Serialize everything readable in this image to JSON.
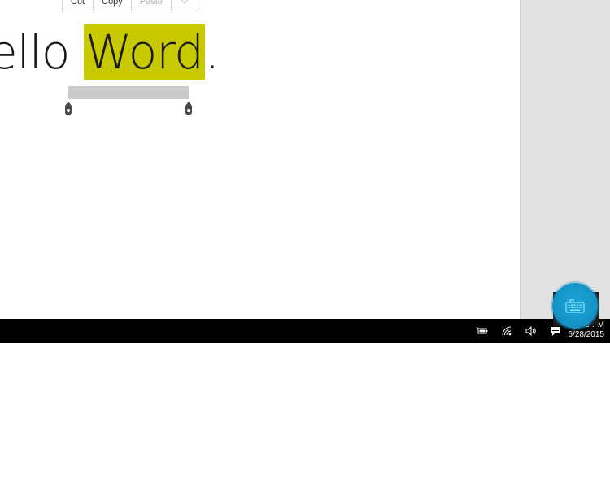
{
  "context_menu": {
    "cut_label": "Cut",
    "copy_label": "Copy",
    "paste_label": "Paste",
    "more_icon": "chevron-down-icon"
  },
  "document": {
    "text_before": "ello ",
    "selected_text": "Word",
    "text_after": ".",
    "selection_color": "#c9c900"
  },
  "taskbar": {
    "time": "2:35 PM",
    "date": "6/28/2015",
    "icons": [
      "battery-icon",
      "wifi-icon",
      "volume-icon",
      "action-center-icon"
    ]
  },
  "floating_button": {
    "icon": "keyboard-icon",
    "color": "#1694c6"
  }
}
